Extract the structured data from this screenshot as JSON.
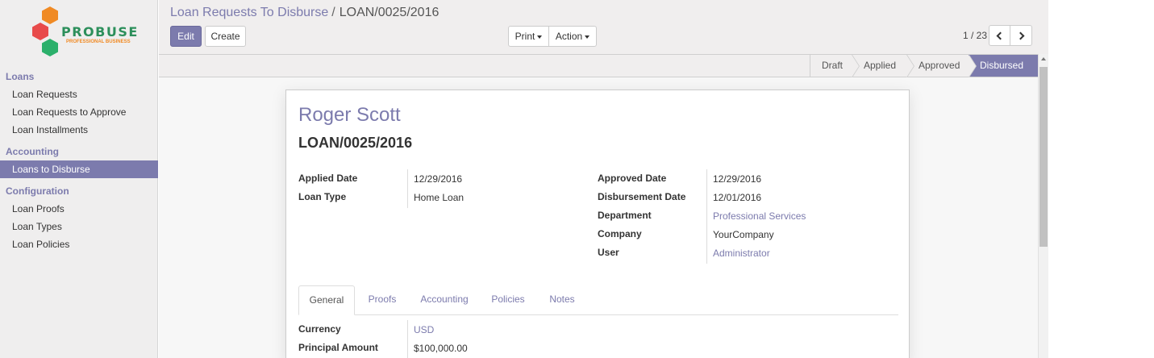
{
  "sidebar": {
    "logo": {
      "brand": "PROBUSE",
      "tagline": "PROFESSIONAL BUSINESS",
      "colors": [
        "#f08a24",
        "#e84b4b",
        "#2cb06b"
      ]
    },
    "sections": [
      {
        "title": "Loans",
        "items": [
          "Loan Requests",
          "Loan Requests to Approve",
          "Loan Installments"
        ]
      },
      {
        "title": "Accounting",
        "items": [
          "Loans to Disburse"
        ]
      },
      {
        "title": "Configuration",
        "items": [
          "Loan Proofs",
          "Loan Types",
          "Loan Policies"
        ]
      }
    ],
    "active_item": "Loans to Disburse"
  },
  "breadcrumb": {
    "parent": "Loan Requests To Disburse",
    "separator": "/",
    "current": "LOAN/0025/2016"
  },
  "buttons": {
    "edit": "Edit",
    "create": "Create",
    "print": "Print",
    "action": "Action"
  },
  "pager": {
    "text": "1 / 23"
  },
  "statusbar": {
    "stages": [
      "Draft",
      "Applied",
      "Approved",
      "Disbursed"
    ],
    "current": "Disbursed"
  },
  "record": {
    "name": "Roger Scott",
    "reference": "LOAN/0025/2016",
    "left_fields": [
      {
        "label": "Applied Date",
        "value": "12/29/2016"
      },
      {
        "label": "Loan Type",
        "value": "Home Loan"
      }
    ],
    "right_fields": [
      {
        "label": "Approved Date",
        "value": "12/29/2016"
      },
      {
        "label": "Disbursement Date",
        "value": "12/01/2016"
      },
      {
        "label": "Department",
        "value": "Professional Services"
      },
      {
        "label": "Company",
        "value": "YourCompany"
      },
      {
        "label": "User",
        "value": "Administrator"
      }
    ],
    "tabs": [
      "General",
      "Proofs",
      "Accounting",
      "Policies",
      "Notes"
    ],
    "active_tab": "General",
    "general_fields": [
      {
        "label": "Currency",
        "value": "USD"
      },
      {
        "label": "Principal Amount",
        "value": "$100,000.00"
      }
    ]
  },
  "colors": {
    "accent": "#7c7bad",
    "control_bg": "#f0eeee",
    "sidebar_bg": "#efeeee"
  }
}
